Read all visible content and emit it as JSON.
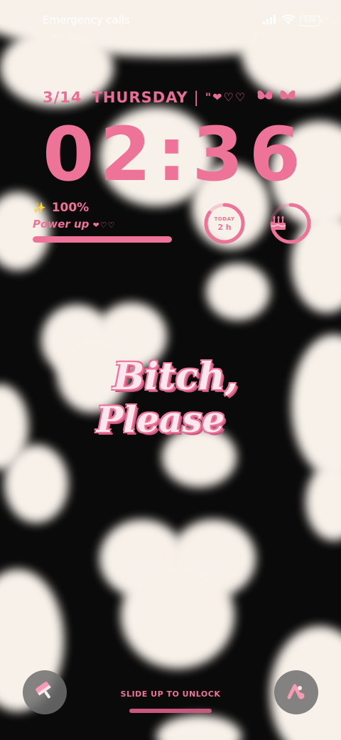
{
  "status_bar": {
    "carrier_text": "Emergency calls o",
    "signal_icon": "signal-bars-icon",
    "wifi_icon": "wifi-icon",
    "battery_level": "100"
  },
  "date": {
    "date": "3/14",
    "weekday": "THURSDAY",
    "separator": "|",
    "hearts": "\"❤♡♡",
    "butterflies": "🦋🦋"
  },
  "clock": {
    "time": "02:36"
  },
  "power_widget": {
    "sparkle": "✨",
    "percent": "100%",
    "label": "Power up",
    "label_hearts": "❤♡♡",
    "level_fraction": 1.0
  },
  "today_widget": {
    "caption": "TODAY",
    "value": "2 h",
    "progress_fraction": 0.85
  },
  "birthday_widget": {
    "icon": "birthday-cake-icon",
    "progress_fraction": 0.75
  },
  "wallpaper_text": {
    "line1": "Bitch,",
    "line2": "Please"
  },
  "bottom": {
    "left_shortcut_icon": "paint-roller-icon",
    "right_shortcut_icon": "theme-app-icon",
    "unlock_hint": "SLIDE UP TO UNLOCK"
  },
  "colors": {
    "accent_pink": "#ee7399",
    "dark_pink": "#c9577d",
    "fur_white": "#f8f1ea",
    "fur_black": "#0a0a0a"
  }
}
